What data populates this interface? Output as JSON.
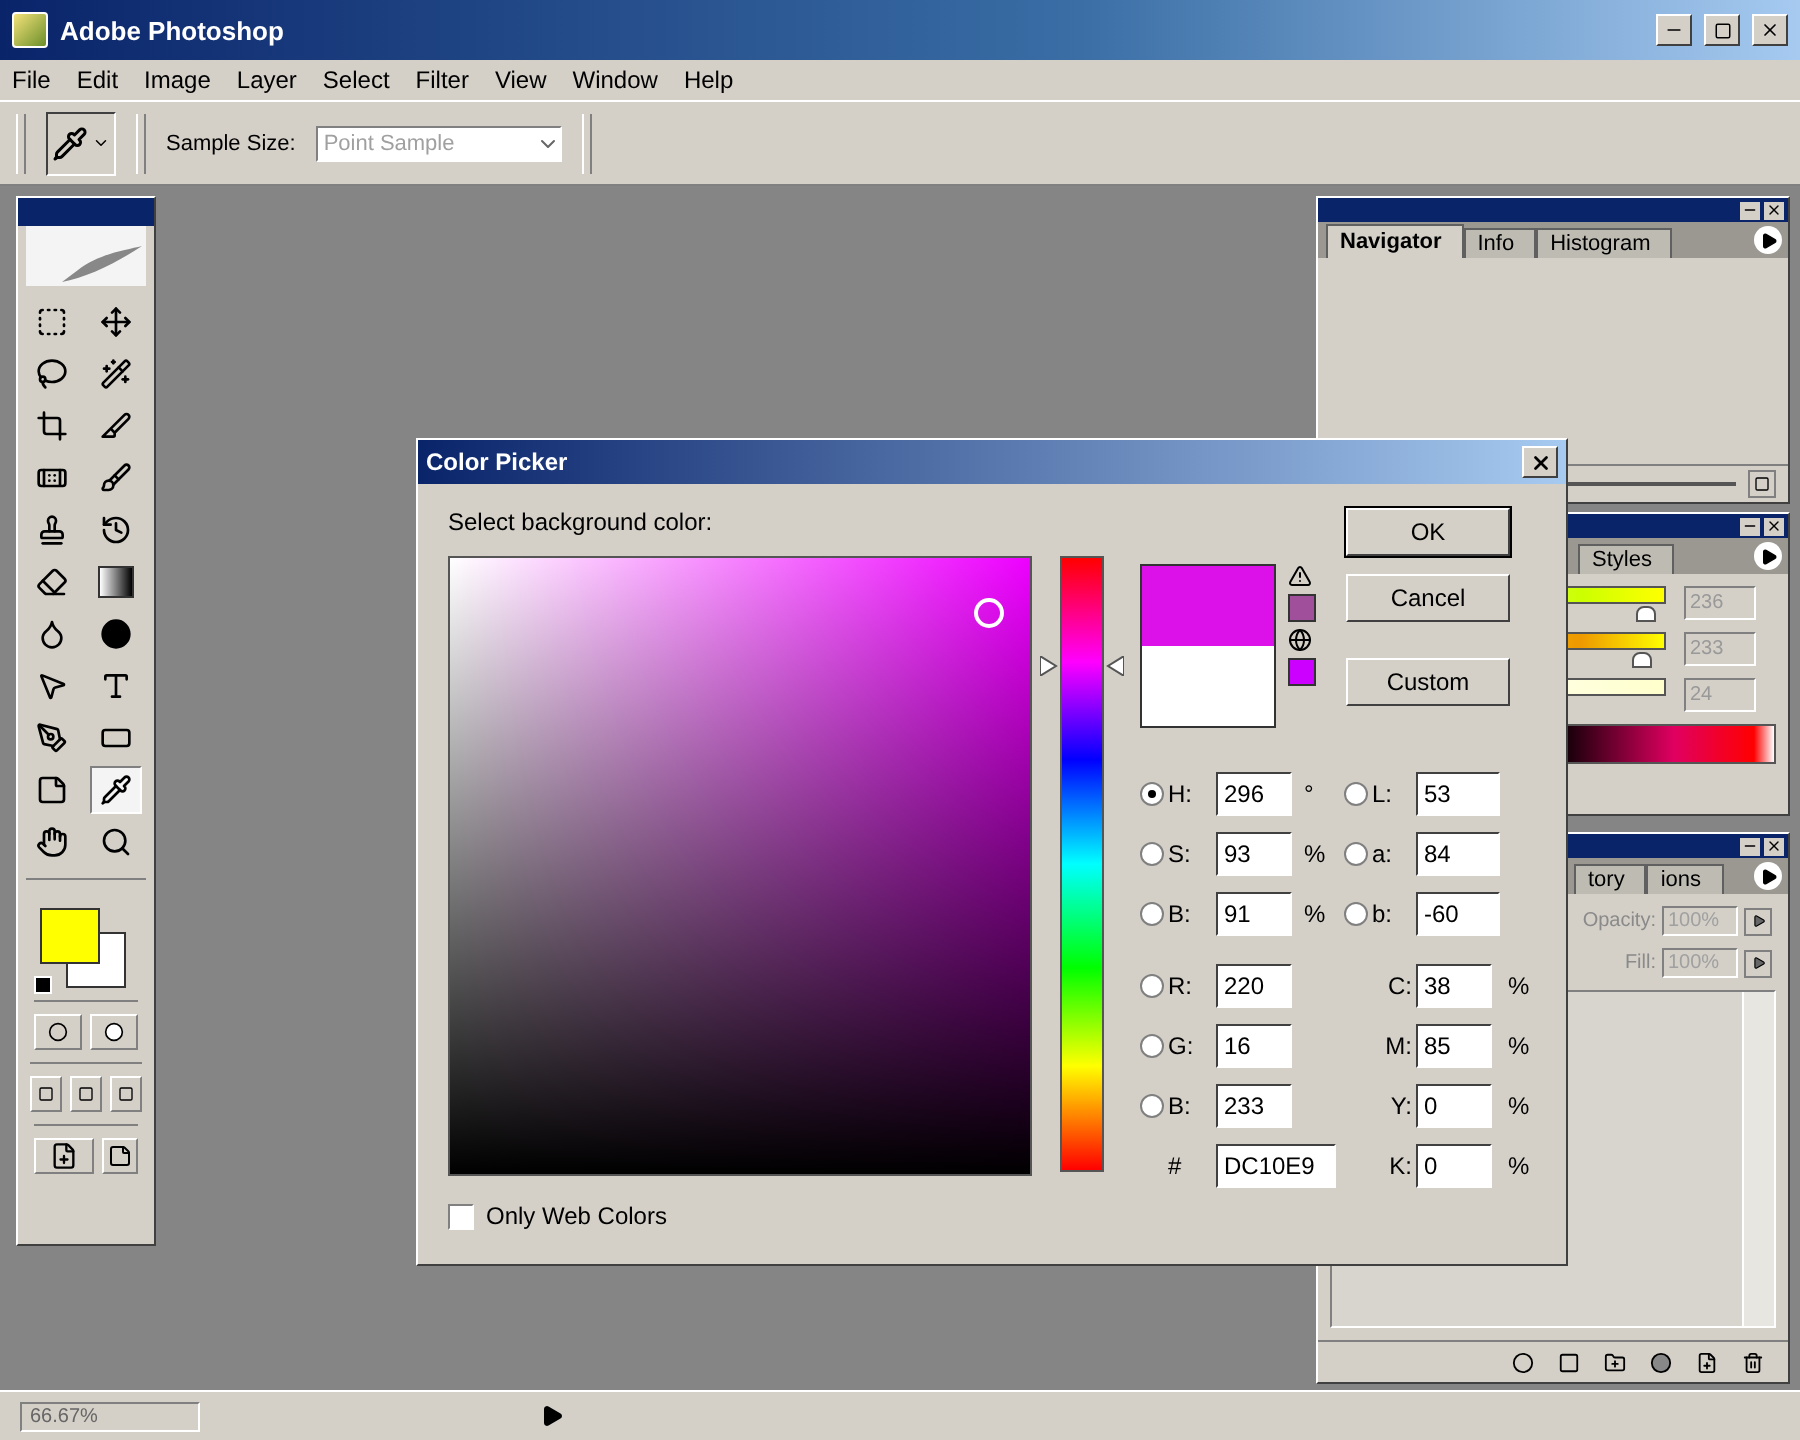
{
  "window": {
    "title": "Adobe Photoshop"
  },
  "menu": [
    "File",
    "Edit",
    "Image",
    "Layer",
    "Select",
    "Filter",
    "View",
    "Window",
    "Help"
  ],
  "options_bar": {
    "sample_size_label": "Sample Size:",
    "sample_size_value": "Point Sample",
    "disabled": true
  },
  "toolbox": {
    "tools": [
      {
        "kind": "marquee",
        "selected": false
      },
      {
        "kind": "move",
        "selected": false
      },
      {
        "kind": "lasso",
        "selected": false
      },
      {
        "kind": "wand",
        "selected": false
      },
      {
        "kind": "crop",
        "selected": false
      },
      {
        "kind": "slice",
        "selected": false
      },
      {
        "kind": "healing",
        "selected": false
      },
      {
        "kind": "brush",
        "selected": false
      },
      {
        "kind": "stamp",
        "selected": false
      },
      {
        "kind": "history",
        "selected": false
      },
      {
        "kind": "eraser",
        "selected": false
      },
      {
        "kind": "gradient",
        "selected": false
      },
      {
        "kind": "blur",
        "selected": false
      },
      {
        "kind": "burn",
        "selected": false
      },
      {
        "kind": "path",
        "selected": false
      },
      {
        "kind": "type",
        "selected": false
      },
      {
        "kind": "pen",
        "selected": false
      },
      {
        "kind": "shape",
        "selected": false
      },
      {
        "kind": "notes",
        "selected": false
      },
      {
        "kind": "eyedropper",
        "selected": true
      },
      {
        "kind": "hand",
        "selected": false
      },
      {
        "kind": "zoom",
        "selected": false
      }
    ]
  },
  "palettes": {
    "navigator": {
      "tabs": [
        {
          "label": "Navigator",
          "selected": true
        },
        {
          "label": "Info",
          "selected": false
        },
        {
          "label": "Histogram",
          "selected": false
        }
      ]
    },
    "color": {
      "tabs": [
        {
          "label": "Styles",
          "selected": false
        }
      ],
      "sliders": [
        {
          "level": 0.93,
          "reading": "236"
        },
        {
          "level": 0.91,
          "reading": "233"
        },
        {
          "level": 0.09,
          "reading": "24"
        }
      ]
    },
    "layers": {
      "tabs": [
        {
          "label": "tory",
          "selected": false
        },
        {
          "label": "ions",
          "selected": false
        }
      ],
      "opacity_label": "Opacity:",
      "opacity_value": "100%",
      "fill_label": "Fill:",
      "fill_value": "100%",
      "disabled": true
    }
  },
  "dialog": {
    "title": "Color Picker",
    "prompt": "Select background color:",
    "hue_slider": {
      "level": 0.82
    },
    "buttons": [
      "OK",
      "Cancel",
      "Custom"
    ],
    "hsb": [
      {
        "label": "H:",
        "value": "296",
        "unit": "°",
        "selected": true
      },
      {
        "label": "S:",
        "value": "93",
        "unit": "%",
        "selected": false
      },
      {
        "label": "B:",
        "value": "91",
        "unit": "%",
        "selected": false
      }
    ],
    "lab": [
      {
        "label": "L:",
        "value": "53",
        "selected": false
      },
      {
        "label": "a:",
        "value": "84",
        "selected": false
      },
      {
        "label": "b:",
        "value": "-60",
        "selected": false
      }
    ],
    "rgb": [
      {
        "label": "R:",
        "value": "220",
        "selected": false
      },
      {
        "label": "G:",
        "value": "16",
        "selected": false
      },
      {
        "label": "B:",
        "value": "233",
        "selected": false
      }
    ],
    "hex": {
      "label": "#",
      "value": "DC10E9"
    },
    "cmyk": [
      {
        "label": "C:",
        "value": "38",
        "unit": "%"
      },
      {
        "label": "M:",
        "value": "85",
        "unit": "%"
      },
      {
        "label": "Y:",
        "value": "0",
        "unit": "%"
      },
      {
        "label": "K:",
        "value": "0",
        "unit": "%"
      }
    ],
    "web_colors": {
      "label": "Only Web Colors",
      "checked": false
    }
  },
  "status_bar": {
    "zoom": "66.67%"
  }
}
